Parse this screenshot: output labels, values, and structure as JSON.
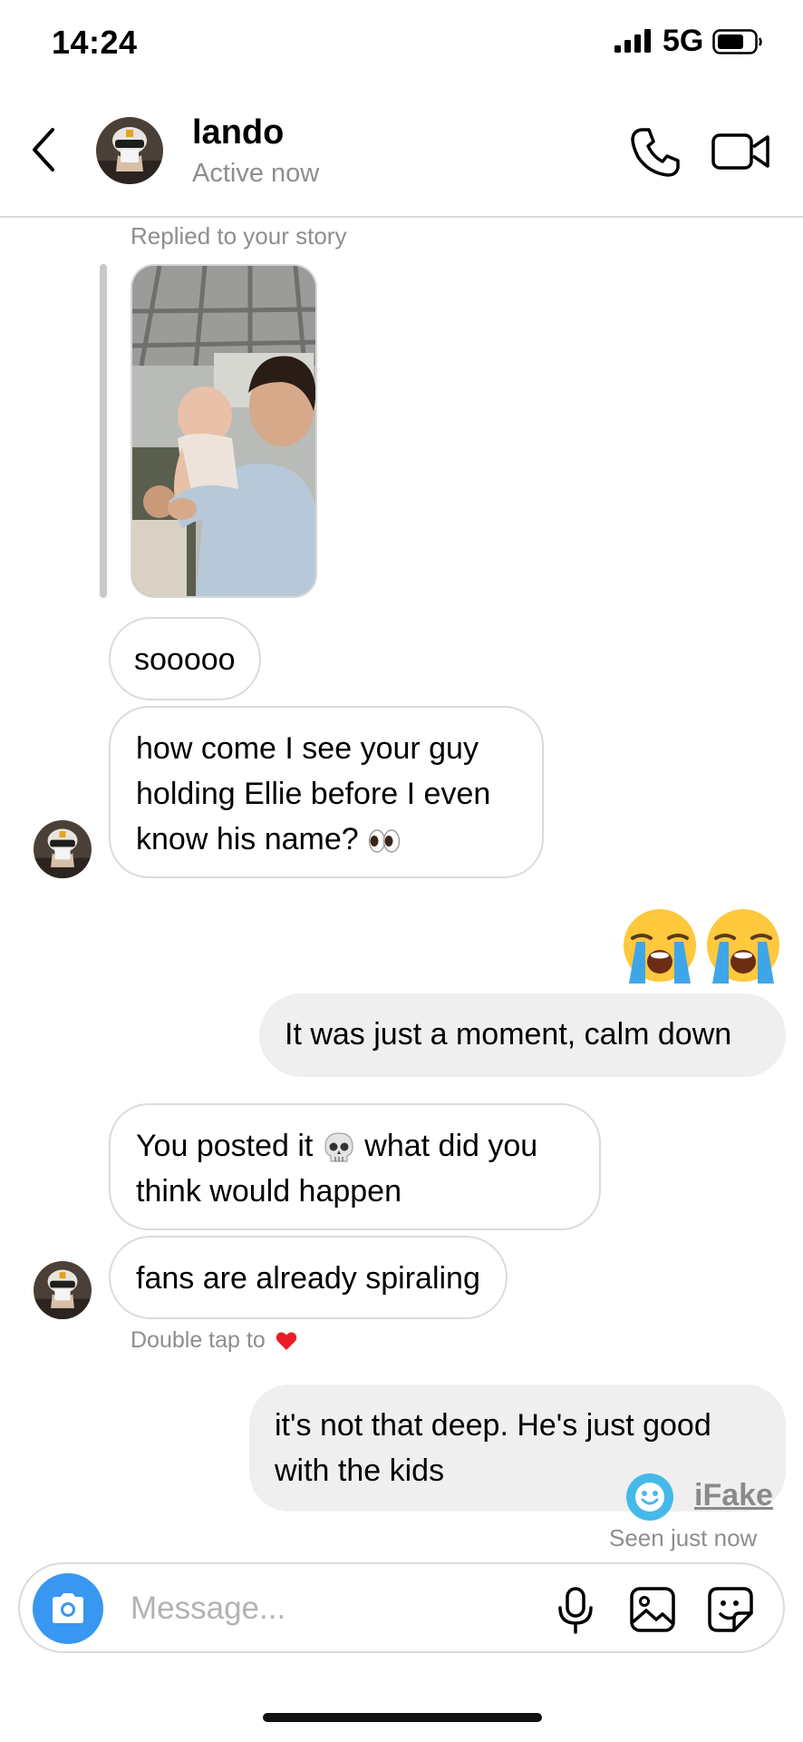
{
  "status_bar": {
    "time": "14:24",
    "network": "5G"
  },
  "header": {
    "name": "lando",
    "status": "Active now"
  },
  "story_reply": {
    "label": "Replied to your story"
  },
  "messages": [
    {
      "from": "them",
      "text": "sooooo"
    },
    {
      "from": "them",
      "line1": "how come I see your guy",
      "line2": "holding Ellie before I even",
      "line3": "know his name?",
      "emoji": "eyes"
    },
    {
      "from": "me",
      "emoji": [
        "loudly-crying-face",
        "loudly-crying-face"
      ]
    },
    {
      "from": "me",
      "text": "It was just a moment, calm down"
    },
    {
      "from": "them",
      "line1_a": "You posted it",
      "line1_emoji": "skull",
      "line1_b": "what did you",
      "line2": "think would happen"
    },
    {
      "from": "them",
      "text": "fans are already spiraling"
    },
    {
      "from": "me",
      "line1": "it's not that deep. He's just good",
      "line2": "with the kids"
    }
  ],
  "double_tap": {
    "text": "Double tap to",
    "icon": "heart-icon",
    "color": "#ed1c24"
  },
  "watermark": {
    "text": "iFake"
  },
  "seen": "Seen just now",
  "composer": {
    "placeholder": "Message..."
  },
  "colors": {
    "accent": "#3897f0",
    "outgoing_bubble": "#efefef",
    "border": "#dbdbdb",
    "muted_text": "#8e8e8e"
  }
}
